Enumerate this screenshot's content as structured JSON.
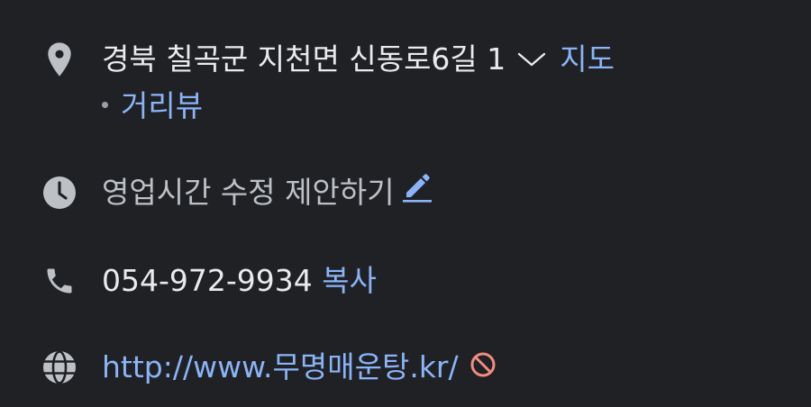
{
  "address": {
    "icon": "location-pin-icon",
    "text": "경북 칠곡군 지천면 신동로6길 1",
    "expand_icon": "chevron-down-icon",
    "map_link": "지도",
    "street_view_link": "거리뷰"
  },
  "hours": {
    "icon": "clock-icon",
    "text": "영업시간 수정 제안하기",
    "edit_icon": "pencil-icon"
  },
  "phone": {
    "icon": "phone-icon",
    "number": "054-972-9934",
    "copy_link": "복사"
  },
  "website": {
    "icon": "globe-icon",
    "url": "http://www.무명매운탕.kr/",
    "warning_icon": "blocked-icon"
  },
  "colors": {
    "background": "#202124",
    "text": "#e8eaed",
    "link": "#8ab4f8",
    "icon": "#bdc1c6",
    "warning": "#f28b82"
  }
}
